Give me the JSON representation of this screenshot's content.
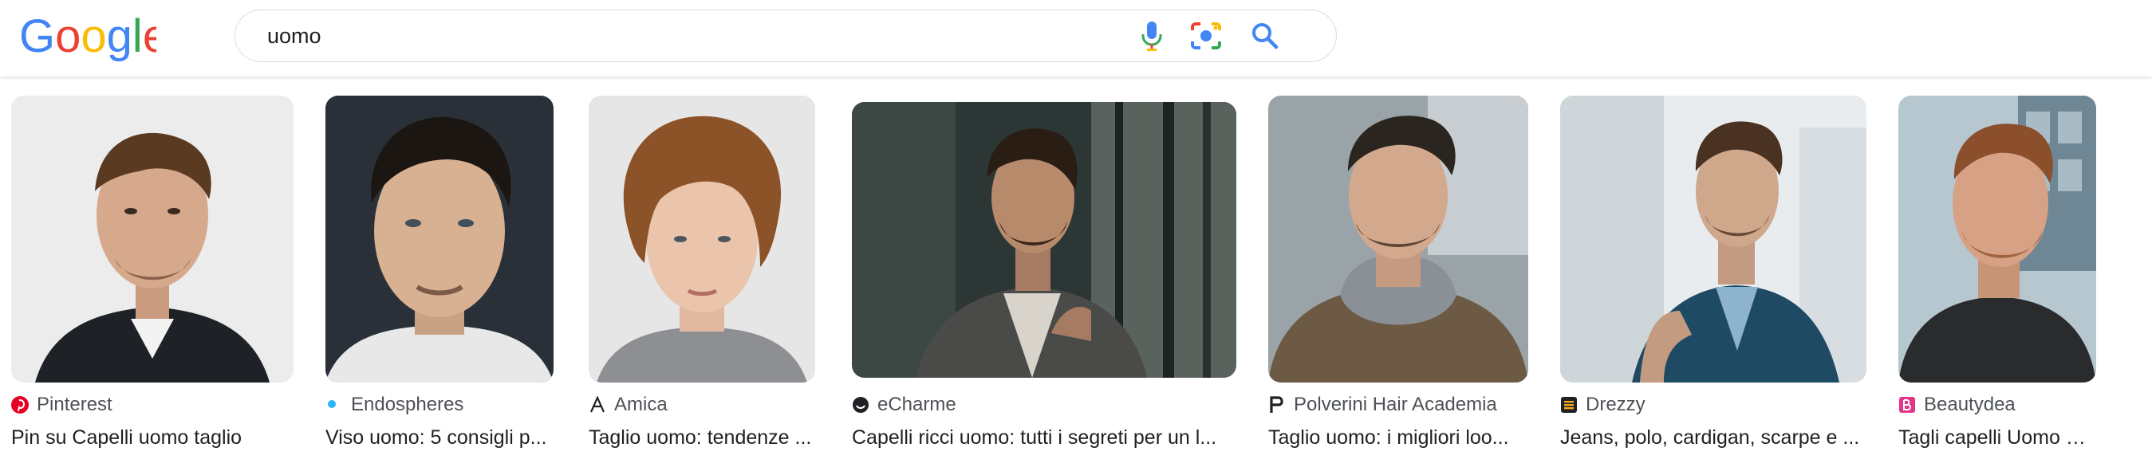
{
  "search": {
    "query": "uomo",
    "voice_icon": "microphone-icon",
    "lens_icon": "camera-lens-icon",
    "search_icon": "magnifier-icon"
  },
  "colors": {
    "google_blue": "#4285F4",
    "google_red": "#EA4335",
    "google_yellow": "#FBBC05",
    "google_green": "#34A853",
    "text": "#202124",
    "source_text": "#4d5156"
  },
  "results": [
    {
      "source": "Pinterest",
      "favicon": "pinterest-icon",
      "title": "Pin su Capelli uomo taglio"
    },
    {
      "source": "Endospheres",
      "favicon": "endospheres-icon",
      "title": "Viso uomo: 5 consigli p..."
    },
    {
      "source": "Amica",
      "favicon": "amica-icon",
      "title": "Taglio uomo: tendenze ..."
    },
    {
      "source": "eCharme",
      "favicon": "echarme-icon",
      "title": "Capelli ricci uomo: tutti i segreti per un l..."
    },
    {
      "source": "Polverini Hair Academia",
      "favicon": "polverini-icon",
      "title": "Taglio uomo: i migliori loo..."
    },
    {
      "source": "Drezzy",
      "favicon": "drezzy-icon",
      "title": "Jeans, polo, cardigan, scarpe e ..."
    },
    {
      "source": "Beautydea",
      "favicon": "beautydea-icon",
      "title": "Tagli capelli Uomo 202..."
    }
  ]
}
